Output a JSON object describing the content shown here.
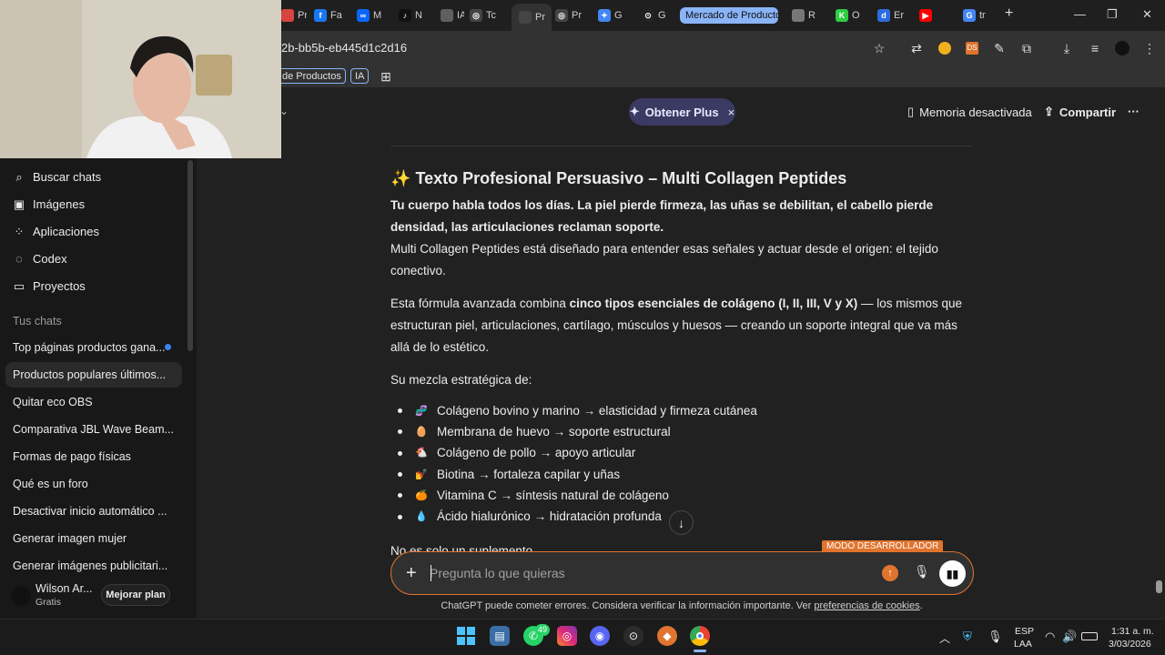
{
  "browser": {
    "tabs": [
      {
        "label": "Pr",
        "color": "#d64541",
        "letter": ""
      },
      {
        "label": "Fa",
        "color": "#1877f2",
        "letter": "f"
      },
      {
        "label": "M",
        "color": "#0a66ff",
        "letter": "∞"
      },
      {
        "label": "N",
        "color": "#111111",
        "letter": "♪"
      },
      {
        "label": "IA",
        "color": "#5f5f5f",
        "letter": ""
      },
      {
        "label": "Tc",
        "color": "#444444",
        "letter": "◎"
      },
      {
        "label": "Pr",
        "color": "#444444",
        "letter": "",
        "active": true
      },
      {
        "label": "Pr",
        "color": "#444444",
        "letter": "◎"
      },
      {
        "label": "G",
        "color": "#4285f4",
        "letter": "✦"
      },
      {
        "label": "G",
        "color": "#222222",
        "letter": "⊙"
      },
      {
        "label": "Mercado de Producto",
        "pill": true
      },
      {
        "label": "R",
        "color": "#777777",
        "letter": ""
      },
      {
        "label": "O",
        "color": "#2ecc40",
        "letter": "K"
      },
      {
        "label": "Er",
        "color": "#2d6cdf",
        "letter": "d"
      },
      {
        "label": "",
        "color": "#ff0000",
        "letter": "▶"
      },
      {
        "label": "tr",
        "color": "#4285f4",
        "letter": "G"
      }
    ],
    "new_tab": "+",
    "url": "2b-bb5b-eb445d1c2d16",
    "bookmarks": {
      "products": "de Productos",
      "ia": "IA"
    }
  },
  "top": {
    "plus_label": "Obtener Plus",
    "plus_close": "×",
    "memory": "Memoria desactivada",
    "share": "Compartir",
    "more": "···"
  },
  "sidebar": {
    "nav": [
      {
        "label": "Buscar chats",
        "icon": "search-icon"
      },
      {
        "label": "Imágenes",
        "icon": "image-icon"
      },
      {
        "label": "Aplicaciones",
        "icon": "apps-icon"
      },
      {
        "label": "Codex",
        "icon": "codex-icon"
      },
      {
        "label": "Proyectos",
        "icon": "folder-icon"
      }
    ],
    "section": "Tus chats",
    "chats": [
      "Top páginas productos gana...",
      "Productos populares últimos...",
      "Quitar eco OBS",
      "Comparativa JBL Wave Beam...",
      "Formas de pago físicas",
      "Qué es un foro",
      "Desactivar inicio automático ...",
      "Generar imagen mujer",
      "Generar imágenes publicitari..."
    ],
    "user": {
      "name": "Wilson Ar...",
      "plan": "Gratis",
      "upgrade": "Mejorar plan"
    }
  },
  "message": {
    "title_emoji": "✨",
    "title": "Texto Profesional Persuasivo – Multi Collagen Peptides",
    "p1_bold": "Tu cuerpo habla todos los días. La piel pierde firmeza, las uñas se debilitan, el cabello pierde densidad, las articulaciones reclaman soporte.",
    "p1_rest": "Multi Collagen Peptides está diseñado para entender esas señales y actuar desde el origen: el tejido conectivo.",
    "p2_a": "Esta fórmula avanzada combina ",
    "p2_bold": "cinco tipos esenciales de colágeno (I, II, III, V y X)",
    "p2_b": " — los mismos que estructuran piel, articulaciones, cartílago, músculos y huesos — creando un soporte integral que va más allá de lo estético.",
    "p3": "Su mezcla estratégica de:",
    "bullets": [
      {
        "emoji": "🧬",
        "text": "Colágeno bovino y marino → elasticidad y firmeza cutánea"
      },
      {
        "emoji": "🥚",
        "text": "Membrana de huevo → soporte estructural"
      },
      {
        "emoji": "🐔",
        "text": "Colágeno de pollo → apoyo articular"
      },
      {
        "emoji": "💅",
        "text": "Biotina → fortaleza capilar y uñas"
      },
      {
        "emoji": "🍊",
        "text": "Vitamina C → síntesis natural de colágeno"
      },
      {
        "emoji": "💧",
        "text": "Ácido hialurónico → hidratación profunda"
      }
    ],
    "p4": "No es solo un suplemento."
  },
  "composer": {
    "placeholder": "Pregunta lo que quieras",
    "dev_badge": "MODO DESARROLLADOR"
  },
  "footer": {
    "disclaimer": "ChatGPT puede cometer errores. Considera verificar la información importante. Ver ",
    "link": "preferencias de cookies",
    "end": "."
  },
  "taskbar": {
    "whatsapp_badge": "49",
    "lang": "ESP",
    "region": "LAA",
    "time": "1:31 a. m.",
    "date": "3/03/2026"
  },
  "colors": {
    "accent": "#e0742e",
    "plus_bg": "#3b3a63",
    "link": "#8ab4f8"
  }
}
